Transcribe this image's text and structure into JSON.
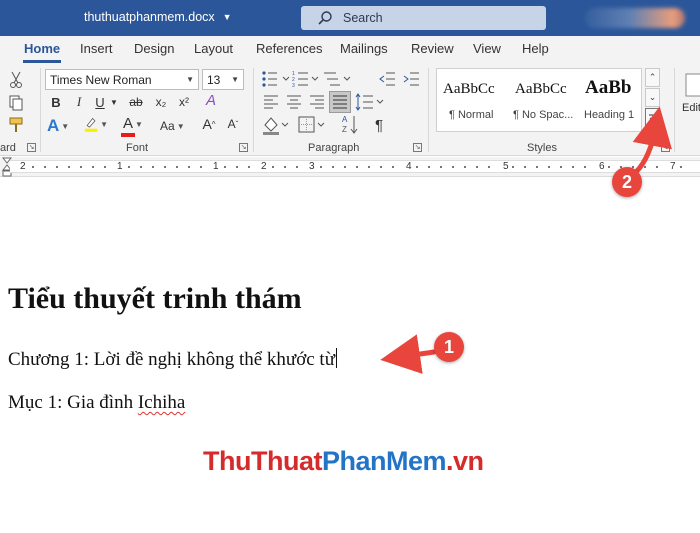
{
  "titlebar": {
    "doc_name": "thuthuatphanmem.docx",
    "search_label": "Search",
    "color": "#2b579a"
  },
  "tabs": [
    {
      "label": "Home",
      "active": true
    },
    {
      "label": "Insert"
    },
    {
      "label": "Design"
    },
    {
      "label": "Layout"
    },
    {
      "label": "References"
    },
    {
      "label": "Mailings"
    },
    {
      "label": "Review"
    },
    {
      "label": "View"
    },
    {
      "label": "Help"
    }
  ],
  "ribbon": {
    "clipboard_label": "ard",
    "font_label": "Font",
    "paragraph_label": "Paragraph",
    "styles_label": "Styles",
    "font_name": "Times New Roman",
    "font_size": "13",
    "bold": "B",
    "italic": "I",
    "underline": "U",
    "strikethrough": "ab",
    "subscript": "x₂",
    "superscript": "x²",
    "clear_format": "A",
    "case": "Aa",
    "grow": "A",
    "shrink": "A",
    "show_marks": "¶",
    "edit_partial": "Edit",
    "styles": [
      {
        "sample": "AaBbCc",
        "name": "¶ Normal"
      },
      {
        "sample": "AaBbCc",
        "name": "¶ No Spac..."
      },
      {
        "sample": "AaBb",
        "name": "Heading 1"
      }
    ]
  },
  "ruler": {
    "numbers": [
      "2",
      "1",
      "1",
      "2",
      "3",
      "4",
      "5",
      "6",
      "7"
    ]
  },
  "document": {
    "heading": "Tiểu thuyết trinh thám",
    "line1": "Chương 1: Lời đề nghị không thể khước từ",
    "line2_prefix": "Mục 1: Gia đình ",
    "line2_misspelled": "Ichiha"
  },
  "watermark": {
    "part1": "Thu",
    "part2": "Thuat",
    "part3": "PhanMem",
    "part4": ".vn",
    "color_red": "#d62b2b",
    "color_blue": "#2374c6"
  },
  "callouts": {
    "one": "1",
    "two": "2",
    "color": "#e8453c"
  }
}
